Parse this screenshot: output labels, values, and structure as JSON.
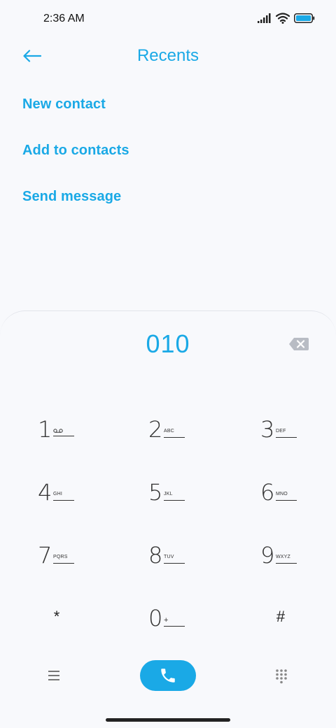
{
  "status_bar": {
    "time": "2:36 AM",
    "icons": [
      "signal-icon",
      "wifi-icon",
      "battery-icon"
    ],
    "battery_color": "#1aa9e6"
  },
  "header": {
    "title": "Recents",
    "back_icon": "arrow-left-icon"
  },
  "actions": [
    {
      "label": "New contact"
    },
    {
      "label": "Add to contacts"
    },
    {
      "label": "Send message"
    }
  ],
  "dialer": {
    "number": "010",
    "backspace_icon": "backspace-icon",
    "keys": [
      {
        "digit": "1",
        "sub": ""
      },
      {
        "digit": "2",
        "sub": "ABC"
      },
      {
        "digit": "3",
        "sub": "DEF"
      },
      {
        "digit": "4",
        "sub": "GHI"
      },
      {
        "digit": "5",
        "sub": "JKL"
      },
      {
        "digit": "6",
        "sub": "MNO"
      },
      {
        "digit": "7",
        "sub": "PQRS"
      },
      {
        "digit": "8",
        "sub": "TUV"
      },
      {
        "digit": "9",
        "sub": "WXYZ"
      },
      {
        "digit": "*",
        "sub": ""
      },
      {
        "digit": "0",
        "sub": "+"
      },
      {
        "digit": "#",
        "sub": ""
      }
    ]
  },
  "bottom_bar": {
    "menu_icon": "menu-icon",
    "call_icon": "phone-icon",
    "keypad_icon": "dialpad-icon"
  },
  "colors": {
    "accent": "#1aa9e6",
    "background": "#f8f9fc"
  }
}
